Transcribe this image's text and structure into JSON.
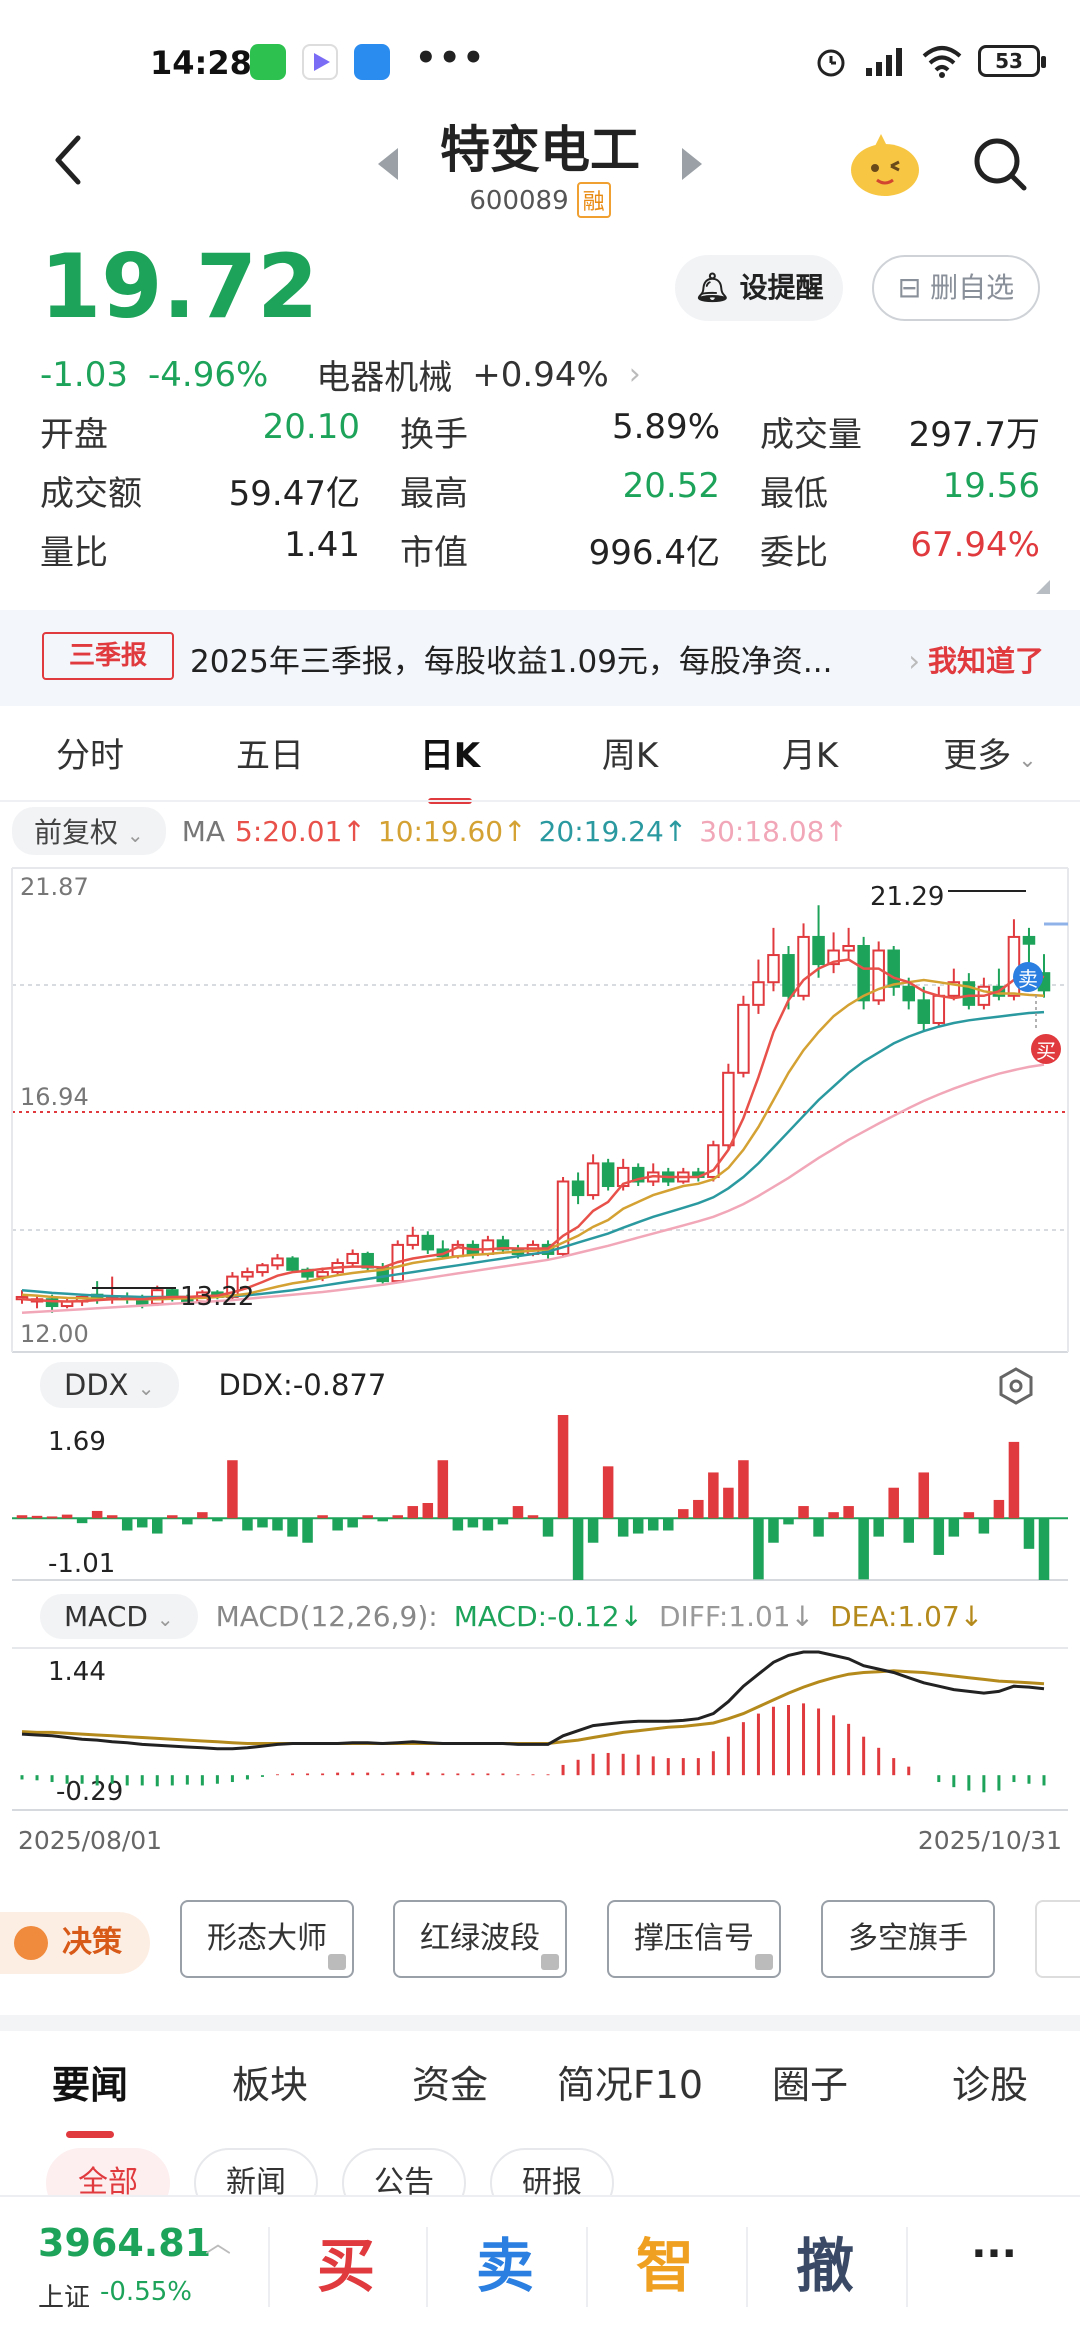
{
  "status_bar": {
    "time": "14:28",
    "icons": [
      "wechat-icon",
      "video-app-icon",
      "wallet-app-icon",
      "more-dots-icon"
    ],
    "right_icons": [
      "alarm-icon",
      "hd-signal-icon",
      "wifi-icon"
    ],
    "battery": "53"
  },
  "header": {
    "title": "特变电工",
    "code": "600089",
    "margin_tag": "融"
  },
  "quote": {
    "price": "19.72",
    "change": "-1.03",
    "change_pct": "-4.96%",
    "sector_name": "电器机械",
    "sector_change": "+0.94%",
    "alert_label": "设提醒",
    "remove_label": "删自选"
  },
  "stats": [
    [
      {
        "label": "开盘",
        "value": "20.10",
        "color": "green"
      },
      {
        "label": "换手",
        "value": "5.89%",
        "color": "dark"
      },
      {
        "label": "成交量",
        "value": "297.7万",
        "color": "dark"
      }
    ],
    [
      {
        "label": "成交额",
        "value": "59.47亿",
        "color": "dark"
      },
      {
        "label": "最高",
        "value": "20.52",
        "color": "green"
      },
      {
        "label": "最低",
        "value": "19.56",
        "color": "green"
      }
    ],
    [
      {
        "label": "量比",
        "value": "1.41",
        "color": "dark"
      },
      {
        "label": "市值",
        "value": "996.4亿",
        "color": "dark"
      },
      {
        "label": "委比",
        "value": "67.94%",
        "color": "red"
      }
    ]
  ],
  "notice": {
    "tag": "三季报",
    "text": "2025年三季报，每股收益1.09元，每股净资...",
    "ack": "我知道了"
  },
  "chart_tabs": [
    "分时",
    "五日",
    "日K",
    "周K",
    "月K",
    "更多"
  ],
  "ma": {
    "adjust": "前复权",
    "label": "MA",
    "ma5": "5:20.01↑",
    "ma10": "10:19.60↑",
    "ma20": "20:19.24↑",
    "ma30": "30:18.08↑"
  },
  "kline_labels": {
    "y_top": "21.87",
    "y_mid": "16.94",
    "y_bottom": "12.00",
    "high_mark": "21.29",
    "low_mark": "13.22",
    "sell_badge": "卖",
    "buy_badge": "买"
  },
  "ddx": {
    "pill": "DDX",
    "value_text": "DDX:-0.877",
    "y_top": "1.69",
    "y_bottom": "-1.01"
  },
  "macd": {
    "pill": "MACD",
    "params": "MACD(12,26,9):",
    "macd": "MACD:-0.12↓",
    "diff": "DIFF:1.01↓",
    "dea": "DEA:1.07↓",
    "y_top": "1.44",
    "y_bottom": "-0.29"
  },
  "dates": {
    "start": "2025/08/01",
    "end": "2025/10/31"
  },
  "tools": {
    "decide": "决策",
    "buttons": [
      "形态大师",
      "红绿波段",
      "撑压信号",
      "多空旗手"
    ]
  },
  "news_tabs": [
    "要闻",
    "板块",
    "资金",
    "简况F10",
    "圈子",
    "诊股"
  ],
  "news_subtabs": [
    "全部",
    "新闻",
    "公告",
    "研报"
  ],
  "bottom_bar": {
    "index_value": "3964.81",
    "index_name": "上证",
    "index_change": "-0.55%",
    "buy": "买",
    "sell": "卖",
    "smart": "智",
    "cancel": "撤",
    "more": "···"
  },
  "colors": {
    "up": "#e03a3e",
    "down": "#1ea35a",
    "ma5": "#e8514a",
    "ma10": "#d4a133",
    "ma20": "#2b9aa0",
    "ma30": "#f2a7b8",
    "dea": "#b58a1c"
  },
  "chart_data": {
    "type": "candlestick",
    "ylim": [
      12.0,
      21.87
    ],
    "candles": [
      [
        12.9,
        12.95,
        12.8,
        13.1
      ],
      [
        12.85,
        12.9,
        12.7,
        13.0
      ],
      [
        12.9,
        12.75,
        12.6,
        13.0
      ],
      [
        12.75,
        12.85,
        12.7,
        12.95
      ],
      [
        12.85,
        12.95,
        12.75,
        13.0
      ],
      [
        13.0,
        12.9,
        12.8,
        13.3
      ],
      [
        12.9,
        12.95,
        12.8,
        13.4
      ],
      [
        12.95,
        12.9,
        12.8,
        13.05
      ],
      [
        12.9,
        12.8,
        12.7,
        13.0
      ],
      [
        12.8,
        13.1,
        12.75,
        13.2
      ],
      [
        13.1,
        12.95,
        12.85,
        13.15
      ],
      [
        12.95,
        12.85,
        12.8,
        13.0
      ],
      [
        12.85,
        13.05,
        12.8,
        13.1
      ],
      [
        13.05,
        12.95,
        12.9,
        13.1
      ],
      [
        12.95,
        13.4,
        12.9,
        13.5
      ],
      [
        13.4,
        13.5,
        13.3,
        13.6
      ],
      [
        13.5,
        13.65,
        13.4,
        13.7
      ],
      [
        13.65,
        13.8,
        13.55,
        13.9
      ],
      [
        13.8,
        13.55,
        13.5,
        13.85
      ],
      [
        13.55,
        13.4,
        13.3,
        13.6
      ],
      [
        13.4,
        13.5,
        13.3,
        13.6
      ],
      [
        13.5,
        13.7,
        13.45,
        13.8
      ],
      [
        13.7,
        13.9,
        13.6,
        14.0
      ],
      [
        13.9,
        13.6,
        13.5,
        13.95
      ],
      [
        13.6,
        13.3,
        13.25,
        13.7
      ],
      [
        13.3,
        14.1,
        13.25,
        14.2
      ],
      [
        14.1,
        14.3,
        14.0,
        14.5
      ],
      [
        14.3,
        14.0,
        13.9,
        14.4
      ],
      [
        14.0,
        13.85,
        13.8,
        14.2
      ],
      [
        13.85,
        14.1,
        13.8,
        14.2
      ],
      [
        14.1,
        13.9,
        13.8,
        14.2
      ],
      [
        13.9,
        14.2,
        13.85,
        14.3
      ],
      [
        14.2,
        14.0,
        13.9,
        14.3
      ],
      [
        14.0,
        13.9,
        13.8,
        14.1
      ],
      [
        13.9,
        14.1,
        13.85,
        14.2
      ],
      [
        14.1,
        13.9,
        13.8,
        14.2
      ],
      [
        13.9,
        15.5,
        13.85,
        15.6
      ],
      [
        15.5,
        15.2,
        15.0,
        15.7
      ],
      [
        15.2,
        15.9,
        15.1,
        16.1
      ],
      [
        15.9,
        15.4,
        15.3,
        16.0
      ],
      [
        15.4,
        15.8,
        15.3,
        16.0
      ],
      [
        15.8,
        15.5,
        15.4,
        15.9
      ],
      [
        15.5,
        15.7,
        15.4,
        15.9
      ],
      [
        15.7,
        15.5,
        15.4,
        15.8
      ],
      [
        15.5,
        15.7,
        15.45,
        15.8
      ],
      [
        15.7,
        15.6,
        15.5,
        15.8
      ],
      [
        15.6,
        16.3,
        15.5,
        16.4
      ],
      [
        16.3,
        17.9,
        16.2,
        18.1
      ],
      [
        17.9,
        19.4,
        17.8,
        19.6
      ],
      [
        19.4,
        19.9,
        19.2,
        20.4
      ],
      [
        19.9,
        20.5,
        19.7,
        21.1
      ],
      [
        20.5,
        19.6,
        19.3,
        20.7
      ],
      [
        19.6,
        20.9,
        19.5,
        21.2
      ],
      [
        20.9,
        20.3,
        20.0,
        21.6
      ],
      [
        20.3,
        20.6,
        20.1,
        21.0
      ],
      [
        20.6,
        20.7,
        20.4,
        21.1
      ],
      [
        20.7,
        19.5,
        19.3,
        20.9
      ],
      [
        19.5,
        20.6,
        19.4,
        20.8
      ],
      [
        20.6,
        19.8,
        19.6,
        20.7
      ],
      [
        19.8,
        19.5,
        19.3,
        20.0
      ],
      [
        19.5,
        19.0,
        18.8,
        19.8
      ],
      [
        19.0,
        19.6,
        18.9,
        19.8
      ],
      [
        19.6,
        19.9,
        19.5,
        20.2
      ],
      [
        19.9,
        19.4,
        19.3,
        20.1
      ],
      [
        19.4,
        19.8,
        19.3,
        20.0
      ],
      [
        19.8,
        19.6,
        19.5,
        20.2
      ],
      [
        19.6,
        20.9,
        19.5,
        21.29
      ],
      [
        20.9,
        20.75,
        20.3,
        21.1
      ],
      [
        20.1,
        19.72,
        19.56,
        20.52
      ]
    ],
    "ma5": [
      12.9,
      12.88,
      12.86,
      12.85,
      12.86,
      12.88,
      12.9,
      12.91,
      12.9,
      12.93,
      12.95,
      12.95,
      12.97,
      12.98,
      13.05,
      13.15,
      13.28,
      13.42,
      13.5,
      13.53,
      13.57,
      13.6,
      13.62,
      13.62,
      13.6,
      13.72,
      13.8,
      13.85,
      13.9,
      14.05,
      14.0,
      14.0,
      14.03,
      14.02,
      14.02,
      14.02,
      14.3,
      14.5,
      14.85,
      15.05,
      15.45,
      15.55,
      15.62,
      15.6,
      15.6,
      15.6,
      15.75,
      16.2,
      16.9,
      17.8,
      18.8,
      19.5,
      19.95,
      20.2,
      20.35,
      20.4,
      20.2,
      20.2,
      20.0,
      19.9,
      19.7,
      19.6,
      19.55,
      19.6,
      19.6,
      19.7,
      19.95,
      20.1,
      20.01
    ],
    "ma10": [
      13.0,
      12.98,
      12.95,
      12.93,
      12.92,
      12.91,
      12.9,
      12.9,
      12.9,
      12.9,
      12.91,
      12.92,
      12.93,
      12.95,
      12.98,
      13.02,
      13.1,
      13.18,
      13.25,
      13.3,
      13.37,
      13.43,
      13.48,
      13.52,
      13.55,
      13.62,
      13.7,
      13.75,
      13.8,
      13.85,
      13.88,
      13.9,
      13.93,
      13.95,
      13.97,
      14.0,
      14.15,
      14.3,
      14.5,
      14.65,
      14.9,
      15.05,
      15.2,
      15.3,
      15.4,
      15.45,
      15.55,
      15.8,
      16.2,
      16.7,
      17.3,
      17.9,
      18.4,
      18.8,
      19.15,
      19.4,
      19.6,
      19.75,
      19.85,
      19.9,
      19.95,
      19.9,
      19.85,
      19.8,
      19.7,
      19.65,
      19.65,
      19.62,
      19.6
    ],
    "ma20": [
      13.1,
      13.07,
      13.04,
      13.02,
      13.0,
      12.98,
      12.97,
      12.96,
      12.95,
      12.95,
      12.95,
      12.95,
      12.95,
      12.96,
      12.97,
      12.99,
      13.02,
      13.06,
      13.1,
      13.15,
      13.2,
      13.25,
      13.3,
      13.35,
      13.4,
      13.45,
      13.5,
      13.55,
      13.6,
      13.65,
      13.7,
      13.75,
      13.8,
      13.85,
      13.9,
      13.95,
      14.05,
      14.15,
      14.25,
      14.35,
      14.48,
      14.6,
      14.72,
      14.82,
      14.92,
      15.02,
      15.15,
      15.35,
      15.6,
      15.9,
      16.25,
      16.6,
      16.95,
      17.3,
      17.6,
      17.9,
      18.15,
      18.35,
      18.55,
      18.7,
      18.82,
      18.92,
      19.0,
      19.06,
      19.1,
      19.14,
      19.18,
      19.22,
      19.24
    ],
    "ma30": [
      12.6,
      12.62,
      12.64,
      12.66,
      12.68,
      12.7,
      12.72,
      12.74,
      12.76,
      12.78,
      12.8,
      12.82,
      12.84,
      12.86,
      12.88,
      12.91,
      12.94,
      12.97,
      13.0,
      13.03,
      13.06,
      13.1,
      13.14,
      13.18,
      13.22,
      13.27,
      13.32,
      13.37,
      13.42,
      13.47,
      13.52,
      13.57,
      13.62,
      13.67,
      13.72,
      13.77,
      13.84,
      13.92,
      14.0,
      14.08,
      14.17,
      14.26,
      14.35,
      14.44,
      14.53,
      14.62,
      14.72,
      14.85,
      15.0,
      15.18,
      15.38,
      15.58,
      15.8,
      16.02,
      16.22,
      16.42,
      16.6,
      16.78,
      16.95,
      17.12,
      17.28,
      17.42,
      17.55,
      17.67,
      17.78,
      17.88,
      17.96,
      18.03,
      18.08
    ],
    "ddx_ylim": [
      -1.01,
      1.69
    ],
    "ddx": [
      0.05,
      0.04,
      0.03,
      0.06,
      -0.08,
      0.12,
      0.05,
      -0.2,
      -0.15,
      -0.25,
      0.05,
      -0.1,
      0.1,
      -0.05,
      0.95,
      -0.2,
      -0.15,
      -0.2,
      -0.3,
      -0.4,
      0.05,
      -0.2,
      -0.15,
      0.05,
      -0.05,
      0.05,
      0.2,
      0.25,
      0.95,
      -0.2,
      -0.15,
      -0.2,
      -0.1,
      0.2,
      0.05,
      -0.3,
      1.69,
      -1.01,
      -0.4,
      0.85,
      -0.3,
      -0.25,
      -0.2,
      -0.2,
      0.15,
      0.3,
      0.75,
      0.5,
      0.95,
      -1.0,
      -0.4,
      -0.1,
      0.2,
      -0.3,
      0.1,
      0.2,
      -1.0,
      -0.3,
      0.5,
      -0.4,
      0.75,
      -0.6,
      -0.3,
      0.1,
      -0.25,
      0.3,
      1.25,
      -0.5,
      -1.01
    ],
    "macd_ylim": [
      -0.29,
      1.44
    ],
    "macd_hist": [
      -0.05,
      -0.06,
      -0.08,
      -0.1,
      -0.1,
      -0.12,
      -0.1,
      -0.12,
      -0.12,
      -0.13,
      -0.12,
      -0.11,
      -0.12,
      -0.1,
      -0.08,
      -0.05,
      -0.02,
      0.01,
      0.02,
      0.02,
      0.02,
      0.03,
      0.03,
      0.03,
      0.02,
      0.03,
      0.04,
      0.03,
      0.02,
      0.02,
      0.02,
      0.02,
      0.02,
      0.01,
      0.01,
      0.01,
      0.12,
      0.18,
      0.25,
      0.26,
      0.25,
      0.24,
      0.22,
      0.2,
      0.2,
      0.2,
      0.28,
      0.45,
      0.62,
      0.72,
      0.8,
      0.82,
      0.84,
      0.78,
      0.7,
      0.6,
      0.45,
      0.32,
      0.2,
      0.1,
      0.0,
      -0.08,
      -0.14,
      -0.18,
      -0.2,
      -0.18,
      -0.08,
      -0.1,
      -0.12
    ],
    "macd_diff": [
      0.48,
      0.47,
      0.46,
      0.44,
      0.42,
      0.41,
      0.39,
      0.38,
      0.36,
      0.35,
      0.34,
      0.33,
      0.32,
      0.31,
      0.31,
      0.32,
      0.34,
      0.36,
      0.37,
      0.37,
      0.37,
      0.37,
      0.38,
      0.38,
      0.37,
      0.38,
      0.39,
      0.38,
      0.37,
      0.37,
      0.37,
      0.37,
      0.37,
      0.36,
      0.36,
      0.36,
      0.46,
      0.52,
      0.58,
      0.6,
      0.62,
      0.63,
      0.63,
      0.63,
      0.64,
      0.66,
      0.72,
      0.86,
      1.04,
      1.18,
      1.32,
      1.4,
      1.44,
      1.44,
      1.4,
      1.36,
      1.28,
      1.24,
      1.2,
      1.14,
      1.08,
      1.04,
      1.0,
      0.98,
      0.96,
      0.98,
      1.04,
      1.03,
      1.01
    ],
    "macd_dea": [
      0.51,
      0.5,
      0.5,
      0.49,
      0.48,
      0.47,
      0.46,
      0.45,
      0.44,
      0.43,
      0.42,
      0.41,
      0.4,
      0.39,
      0.38,
      0.37,
      0.37,
      0.37,
      0.37,
      0.37,
      0.37,
      0.37,
      0.37,
      0.37,
      0.37,
      0.37,
      0.37,
      0.37,
      0.37,
      0.37,
      0.37,
      0.37,
      0.37,
      0.37,
      0.37,
      0.37,
      0.39,
      0.41,
      0.44,
      0.47,
      0.5,
      0.52,
      0.54,
      0.56,
      0.57,
      0.59,
      0.61,
      0.66,
      0.72,
      0.8,
      0.88,
      0.96,
      1.03,
      1.09,
      1.14,
      1.18,
      1.2,
      1.21,
      1.22,
      1.21,
      1.2,
      1.18,
      1.16,
      1.14,
      1.12,
      1.1,
      1.09,
      1.08,
      1.07
    ]
  }
}
